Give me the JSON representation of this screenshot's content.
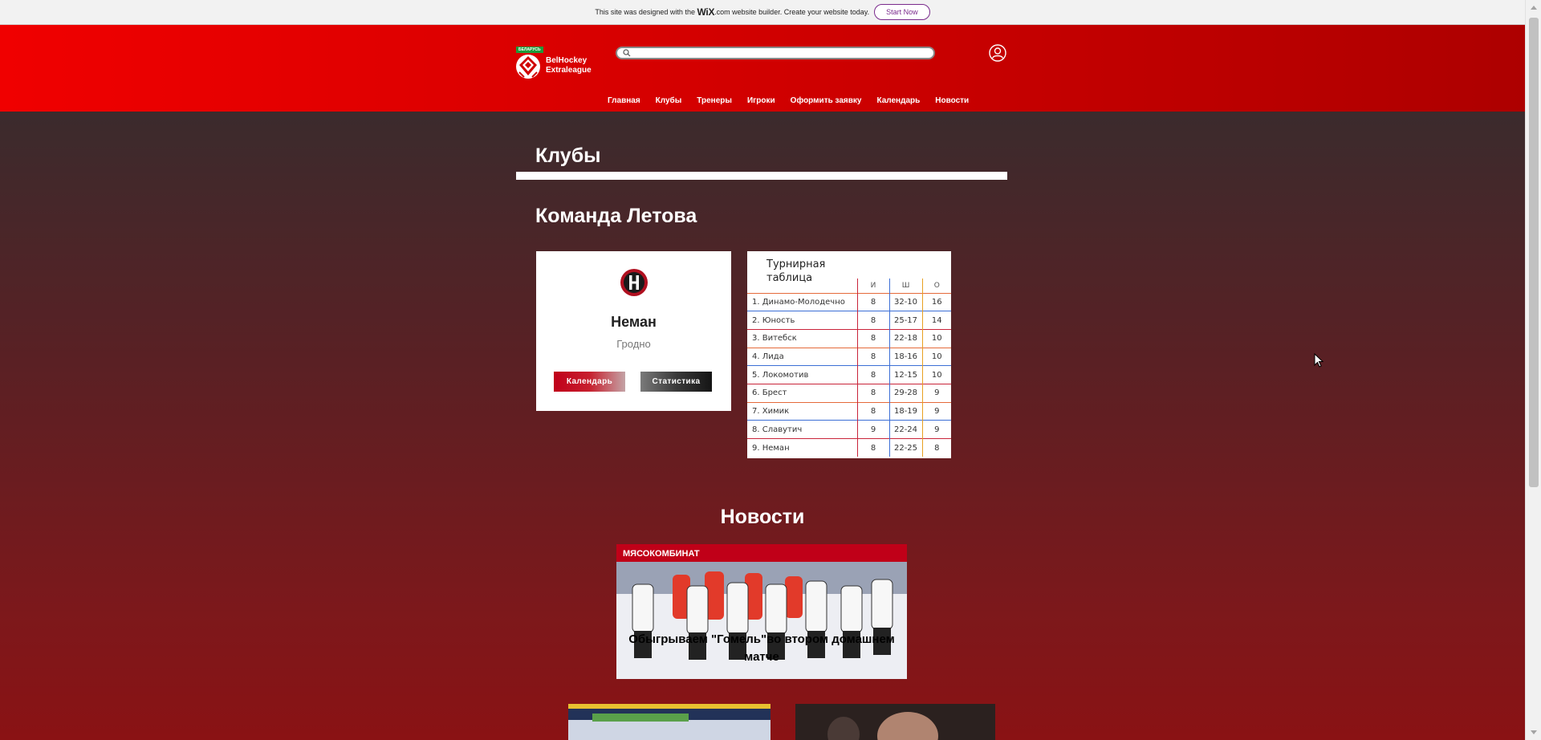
{
  "wix_banner": {
    "text_before": "This site was designed with the",
    "brand": "WiX",
    "text_after": ".com website builder. Create your website today.",
    "cta": "Start Now"
  },
  "header": {
    "logo_tag": "БЕЛАРУСЬ",
    "logo_line1": "BelHockey",
    "logo_line2": "Extraleague",
    "search_placeholder": "",
    "nav": [
      "Главная",
      "Клубы",
      "Тренеры",
      "Игроки",
      "Оформить заявку",
      "Календарь",
      "Новости"
    ]
  },
  "main": {
    "page_title": "Клубы",
    "team_heading": "Команда Летова",
    "club_card": {
      "name": "Неман",
      "city": "Гродно",
      "calendar_button": "Календарь",
      "stats_button": "Статистика"
    },
    "standings": {
      "title": "Турнирная таблица",
      "columns": [
        "И",
        "Ш",
        "О"
      ],
      "rows": [
        {
          "team": "1. Динамо-Молодечно",
          "games": "8",
          "goals": "32-10",
          "points": "16"
        },
        {
          "team": "2. Юность",
          "games": "8",
          "goals": "25-17",
          "points": "14"
        },
        {
          "team": "3. Витебск",
          "games": "8",
          "goals": "22-18",
          "points": "10"
        },
        {
          "team": "4. Лида",
          "games": "8",
          "goals": "18-16",
          "points": "10"
        },
        {
          "team": "5. Локомотив",
          "games": "8",
          "goals": "12-15",
          "points": "10"
        },
        {
          "team": "6. Брест",
          "games": "8",
          "goals": "29-28",
          "points": "9"
        },
        {
          "team": "7. Химик",
          "games": "8",
          "goals": "18-19",
          "points": "9"
        },
        {
          "team": "8. Славутич",
          "games": "9",
          "goals": "22-24",
          "points": "9"
        },
        {
          "team": "9. Неман",
          "games": "8",
          "goals": "22-25",
          "points": "8"
        }
      ]
    },
    "news_heading": "Новости",
    "news_image_sign": "МЯСОКОМБИНАТ",
    "news_caption": "Обыгрываем \"Гомель\"во втором домашнем матче"
  },
  "colors": {
    "header_left": "#f00000",
    "header_right": "#ad0000",
    "accent_red": "#c0001a",
    "wix_purple": "#7a2a8c"
  }
}
